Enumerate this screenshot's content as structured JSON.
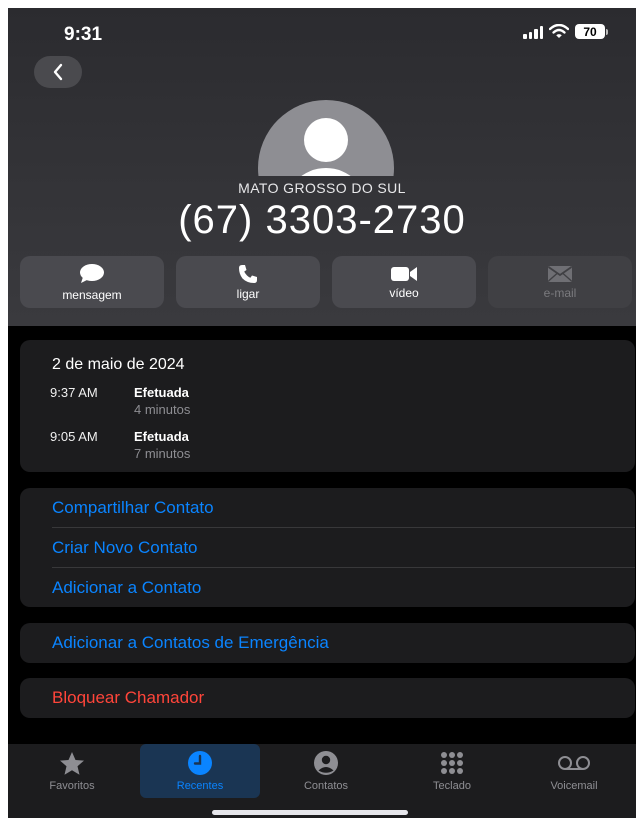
{
  "status_bar": {
    "time": "9:31",
    "battery": "70"
  },
  "contact": {
    "region": "MATO GROSSO DO SUL",
    "phone": "(67) 3303-2730"
  },
  "actions": [
    {
      "label": "mensagem",
      "icon": "message-icon",
      "enabled": true
    },
    {
      "label": "ligar",
      "icon": "phone-icon",
      "enabled": true
    },
    {
      "label": "vídeo",
      "icon": "video-icon",
      "enabled": true
    },
    {
      "label": "e-mail",
      "icon": "mail-icon",
      "enabled": false
    }
  ],
  "history": {
    "date": "2 de maio de 2024",
    "calls": [
      {
        "time": "9:37 AM",
        "type": "Efetuada",
        "duration": "4 minutos"
      },
      {
        "time": "9:05 AM",
        "type": "Efetuada",
        "duration": "7 minutos"
      }
    ]
  },
  "options": {
    "share": "Compartilhar Contato",
    "create": "Criar Novo Contato",
    "add": "Adicionar a Contato",
    "emergency": "Adicionar a Contatos de Emergência",
    "block": "Bloquear Chamador"
  },
  "tabs": [
    {
      "label": "Favoritos",
      "icon": "star-icon",
      "active": false
    },
    {
      "label": "Recentes",
      "icon": "clock-icon",
      "active": true
    },
    {
      "label": "Contatos",
      "icon": "person-circle-icon",
      "active": false
    },
    {
      "label": "Teclado",
      "icon": "keypad-icon",
      "active": false
    },
    {
      "label": "Voicemail",
      "icon": "voicemail-icon",
      "active": false
    }
  ],
  "colors": {
    "accent": "#0a84ff",
    "destructive": "#ff453a",
    "card": "#1c1c1e"
  }
}
